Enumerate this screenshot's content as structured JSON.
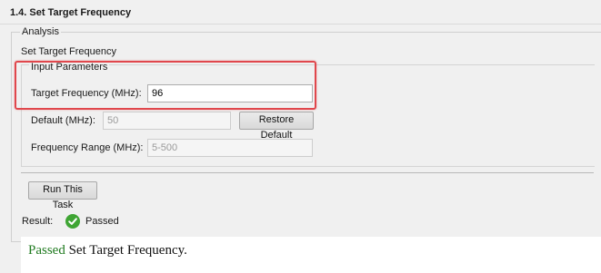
{
  "section": {
    "title": "1.4. Set Target Frequency"
  },
  "analysis": {
    "legend": "Analysis",
    "subtitle": "Set Target Frequency"
  },
  "input_parameters": {
    "legend": "Input Parameters",
    "target_frequency": {
      "label": "Target Frequency (MHz):",
      "value": "96"
    },
    "default": {
      "label": "Default (MHz):",
      "value": "50"
    },
    "restore_default_label": "Restore Default",
    "frequency_range": {
      "label": "Frequency Range (MHz):",
      "value": "5-500"
    }
  },
  "run_task_label": "Run This Task",
  "result": {
    "label": "Result:",
    "status": "Passed",
    "status_icon": "check-circle-icon",
    "message_status": "Passed",
    "message_text": "Set Target Frequency.",
    "colors": {
      "passed_green": "#1f7a1f",
      "highlight_red": "#e0474c"
    }
  }
}
